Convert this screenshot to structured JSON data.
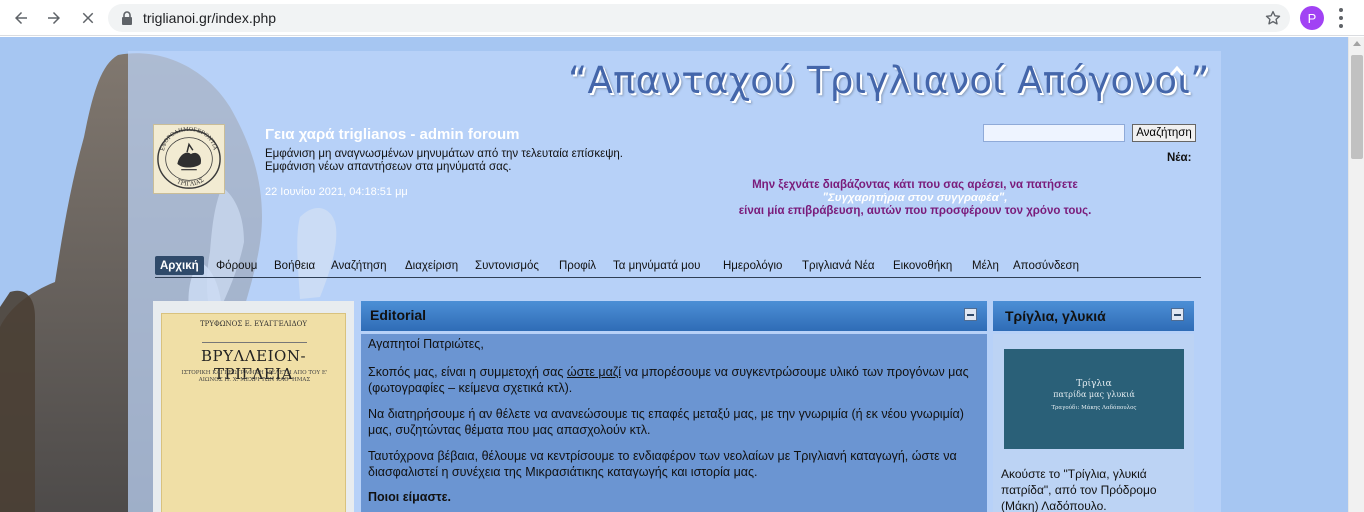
{
  "browser": {
    "url": "triglianoi.gr/index.php",
    "profile_initial": "P",
    "icons": {
      "back": "arrow-left-icon",
      "forward": "arrow-right-icon",
      "reload": "close-icon",
      "lock": "lock-icon",
      "bookmark": "star-icon",
      "menu": "three-dots-icon"
    }
  },
  "site": {
    "title": "“Απανταχού Τριγλιανοί Απόγονοι”",
    "logo_text_top": "ΕΦΟΡΟΔΗΜΟΓΕΡΟΝΤΙΑ",
    "logo_text_bottom": "ΤΡΙΓΛΙΑΣ"
  },
  "header": {
    "greeting": "Γεια χαρά triglianos - admin foroum",
    "line1": "Εμφάνιση μη αναγνωσμένων μηνυμάτων από την τελευταία επίσκεψη.",
    "line2": "Εμφάνιση νέων απαντήσεων στα μηνύματά σας.",
    "date": "22 Ιουνίου 2021, 04:18:51 μμ",
    "search_value": "",
    "search_button": "Αναζήτηση",
    "news_label": "Νέα:",
    "promo_line1": "Μην ξεχνάτε διαβάζοντας κάτι που σας αρέσει, να πατήσετε",
    "promo_line2": "\"Συγχαρητήρια στον συγγραφέα\",",
    "promo_line3": "είναι μία επιβράβευση, αυτών που προσφέρουν τον χρόνο τους."
  },
  "menu": {
    "items": [
      "Αρχική",
      "Φόρουμ",
      "Βοήθεια",
      "Αναζήτηση",
      "Διαχείριση",
      "Συντονισμός",
      "Προφίλ",
      "Τα μηνύματά μου",
      "Ημερολόγιο",
      "Τριγλιανά Νέα",
      "Εικονοθήκη",
      "Μέλη",
      "Αποσύνδεση"
    ]
  },
  "book": {
    "author": "ΤΡΥΦΩΝΟΣ Ε. ΕΥΑΓΓΕΛΙΔΟΥ",
    "title": "ΒΡΥΛΛΕΙΟΝ-ΤΡΙΓΛΕΙΑ",
    "subtitle": "ΙΣΤΟΡΙΚΗ ΚΑΙ ΓΕΩΓΡΑΦΙΚΗ ΜΕΛΕΤΗ ΑΠΟ ΤΟΥ Ε' ΑΙΩΝΟΣ Π. Χ. ΜΕΧΡΙ ΤΩΝ ΚΑΘ' ΗΜΑΣ"
  },
  "editorial": {
    "title": "Editorial",
    "p1": "Αγαπητοί Πατριώτες,",
    "p2_before": "Σκοπός μας, είναι η συμμετοχή σας ",
    "p2_link": "ώστε μαζί",
    "p2_after": " να μπορέσουμε να συγκεντρώσουμε υλικό των προγόνων μας (φωτογραφίες – κείμενα σχετικά κτλ).",
    "p3": "Να διατηρήσουμε ή αν θέλετε να ανανεώσουμε τις επαφές μεταξύ μας, με την γνωριμία (ή εκ νέου γνωριμία) μας, συζητώντας θέματα που μας απασχολούν κτλ.",
    "p4": "Ταυτόχρονα βέβαια, θέλουμε να κεντρίσουμε το ενδιαφέρον των νεολαίων με Τριγλιανή καταγωγή, ώστε να διασφαλιστεί η συνέχεια της Μικρασιάτικης καταγωγής και ιστορία μας.",
    "p5": "Ποιοι είμαστε."
  },
  "right_box": {
    "title": "Τρίγλια, γλυκιά",
    "thumb_line1": "Τρίγλια",
    "thumb_line2": "πατρίδα μας γλυκιά",
    "thumb_line3": "Τραγούδι: Μάκης Λαδόπουλος",
    "text": "Ακούστε το \"Τρίγλια, γλυκιά πατρίδα\", από τον Πρόδρομο (Μάκη) Λαδόπουλο."
  }
}
